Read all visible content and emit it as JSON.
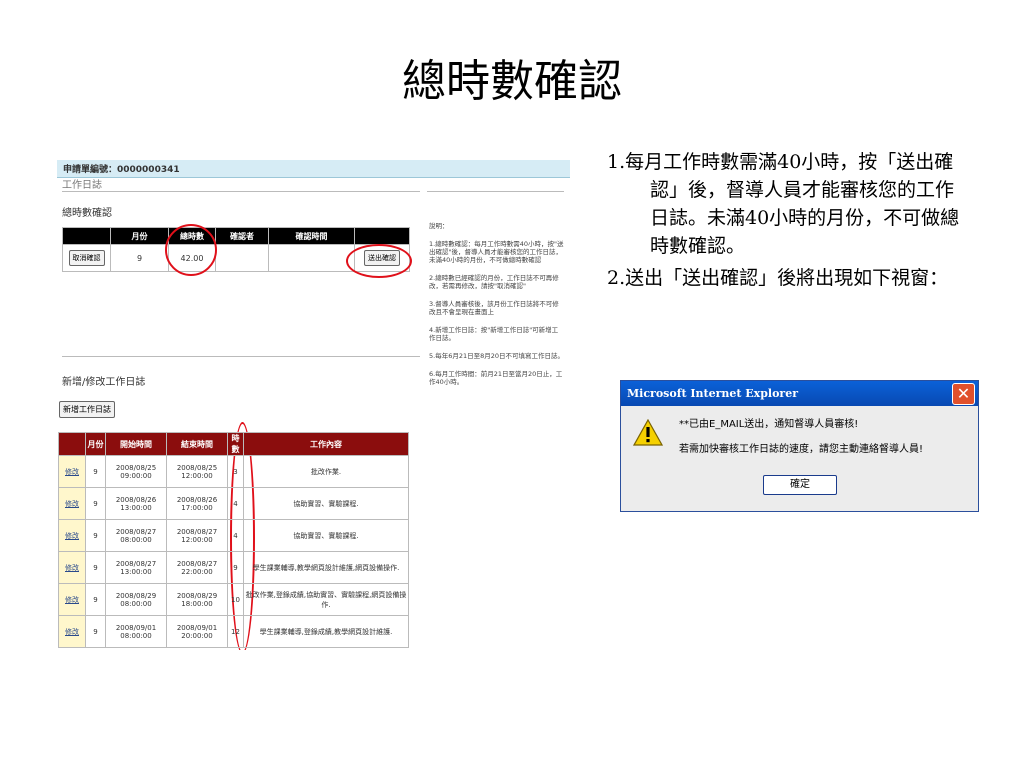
{
  "slide": {
    "title": "總時數確認",
    "notes": [
      "1.每月工作時數需滿40小時，按「送出確認」後，督導人員才能審核您的工作日誌。未滿40小時的月份，不可做總時數確認。",
      "2.送出「送出確認」後將出現如下視窗："
    ]
  },
  "screenshot": {
    "application_number": "申請單編號：0000000341",
    "section_caption": "工作日誌",
    "confirm_section": {
      "heading": "總時數確認",
      "headers": [
        "",
        "月份",
        "總時數",
        "確認者",
        "確認時間",
        ""
      ],
      "row": {
        "cancel_button": "取消確認",
        "month": "9",
        "total_hours": "42.00",
        "confirmer": "",
        "confirm_time": "",
        "submit_button": "送出確認"
      }
    },
    "sidebar": {
      "title": "說明：",
      "items": [
        "1.總時數確認：每月工作時數需40小時，按\"送出確認\"後，督導人員才能審核您的工作日誌，未滿40小時的月份，不可做總時數確認",
        "2.總時數已經確認的月份，工作日誌不可再修改，若需再修改，請按\"取消確認\"",
        "3.督導人員審核後，該月份工作日誌將不可修改且不會呈現在畫面上",
        "4.新增工作日誌：按\"新增工作日誌\"可新增工作日誌。",
        "5.每年6月21日至8月20日不可填寫工作日誌。",
        "6.每月工作時間：前月21日至當月20日止，工作40小時。"
      ]
    },
    "log_section": {
      "heading": "新增/修改工作日誌",
      "add_button": "新增工作日誌",
      "headers": [
        "",
        "月份",
        "開始時間",
        "結束時間",
        "時數",
        "工作內容"
      ],
      "rows": [
        {
          "action": "修改",
          "month": "9",
          "start": "2008/08/25 09:00:00",
          "end": "2008/08/25 12:00:00",
          "hours": "3",
          "content": "批改作業."
        },
        {
          "action": "修改",
          "month": "9",
          "start": "2008/08/26 13:00:00",
          "end": "2008/08/26 17:00:00",
          "hours": "4",
          "content": "協助實習、實驗課程."
        },
        {
          "action": "修改",
          "month": "9",
          "start": "2008/08/27 08:00:00",
          "end": "2008/08/27 12:00:00",
          "hours": "4",
          "content": "協助實習、實驗課程."
        },
        {
          "action": "修改",
          "month": "9",
          "start": "2008/08/27 13:00:00",
          "end": "2008/08/27 22:00:00",
          "hours": "9",
          "content": "學生課業輔導,教學網頁設計維護,網頁設備操作."
        },
        {
          "action": "修改",
          "month": "9",
          "start": "2008/08/29 08:00:00",
          "end": "2008/08/29 18:00:00",
          "hours": "10",
          "content": "批改作業,登錄成績,協助實習、實驗課程,網頁設備操作."
        },
        {
          "action": "修改",
          "month": "9",
          "start": "2008/09/01 08:00:00",
          "end": "2008/09/01 20:00:00",
          "hours": "12",
          "content": "學生課業輔導,登錄成績,教學網頁設計維護."
        }
      ]
    }
  },
  "dialog": {
    "title": "Microsoft Internet Explorer",
    "line1": "**已由E_MAIL送出，通知督導人員審核!",
    "line2": "若需加快審核工作日誌的速度，請您主動連絡督導人員!",
    "ok_button": "確定",
    "icon": "warning-icon"
  },
  "colors": {
    "header_bar": "#d6ecf5",
    "table_header": "#000000",
    "log_header": "#8b0d0d",
    "highlight_circle": "#e0101a",
    "dialog_title": "#0b61d8",
    "dialog_close": "#e0502c"
  }
}
